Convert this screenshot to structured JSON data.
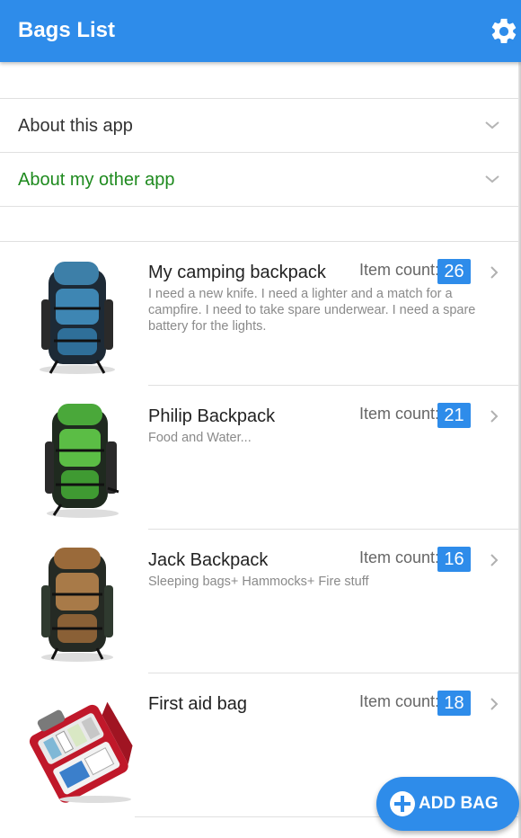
{
  "header": {
    "title": "Bags List",
    "settings_icon": "gear-icon",
    "bg_color": "#2e8cea"
  },
  "accordion": [
    {
      "label": "About this app",
      "color": "#333333"
    },
    {
      "label": "About my other app",
      "color": "#1e8a1e"
    }
  ],
  "bags": [
    {
      "name": "My camping backpack",
      "description": "I need a new knife. I need a lighter and a match for a campfire. I need to take spare underwear. I need a spare battery for the lights.",
      "count_label": "Item count:",
      "count": "26",
      "image": "blue-backpack"
    },
    {
      "name": "Philip Backpack",
      "description": "Food and Water...",
      "count_label": "Item count:",
      "count": "21",
      "image": "green-backpack"
    },
    {
      "name": "Jack Backpack",
      "description": "Sleeping bags+ Hammocks+ Fire stuff",
      "count_label": "Item count:",
      "count": "16",
      "image": "brown-backpack"
    },
    {
      "name": "First aid bag",
      "description": "",
      "count_label": "Item count:",
      "count": "18",
      "image": "first-aid-kit"
    }
  ],
  "fab": {
    "label": "ADD BAG",
    "icon": "plus-circle-icon"
  }
}
